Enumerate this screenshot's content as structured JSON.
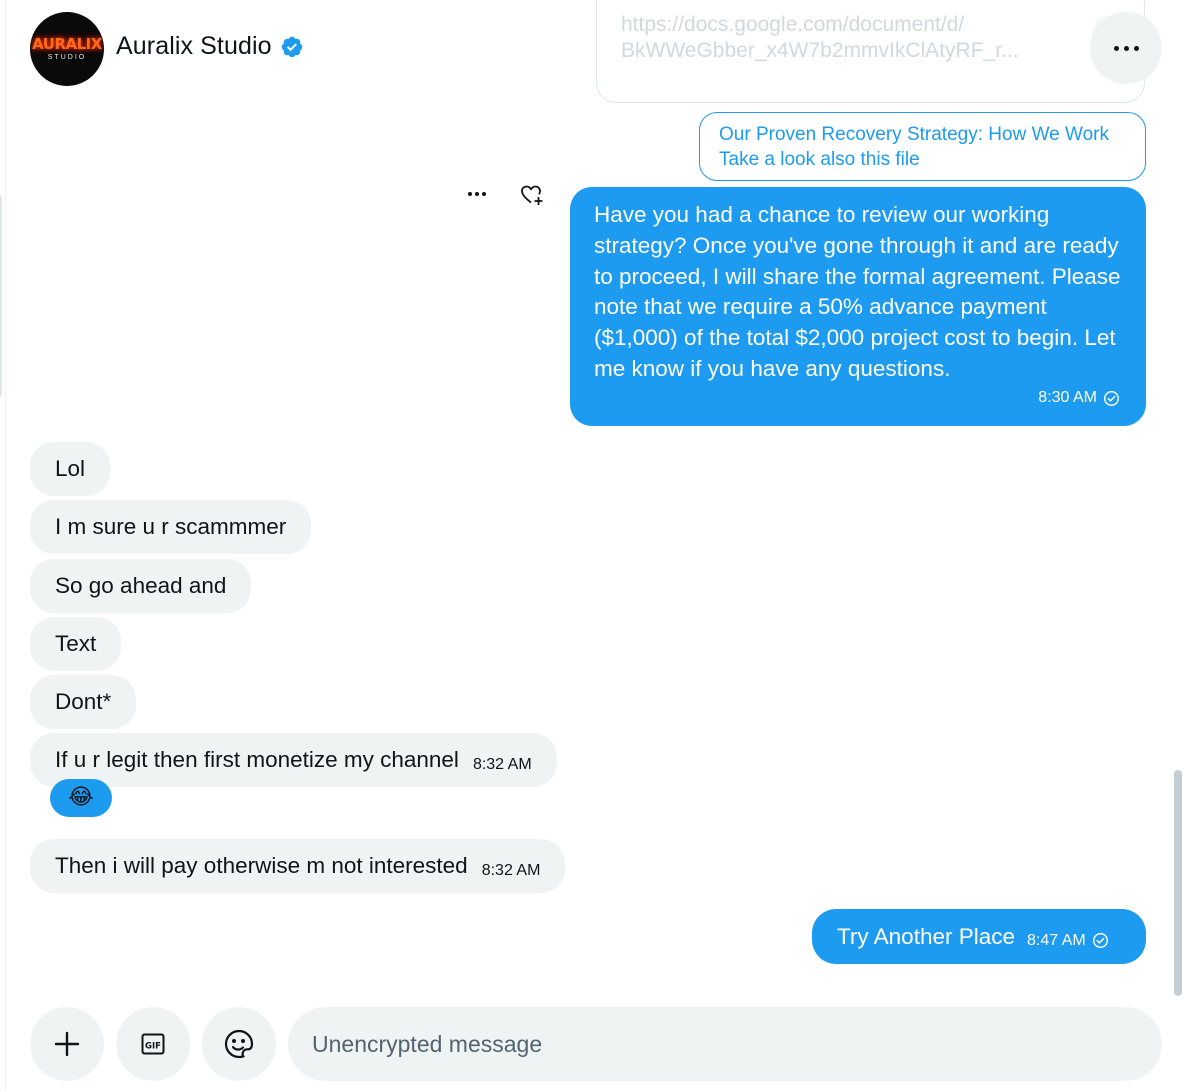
{
  "header": {
    "name": "Auralix Studio",
    "avatar_logo": "AURALIX",
    "avatar_sub": "STUDIO",
    "verified_icon": "verified-badge-icon",
    "more_icon": "more-horizontal-icon"
  },
  "link_preview": {
    "url_line1": "https://docs.google.com/document/d/",
    "url_line2": "BkWWeGbber_x4W7b2mmvIkClAtyRF_r..."
  },
  "outline_message": {
    "line1": "Our Proven Recovery Strategy: How We Work",
    "line2": "Take a look also this file"
  },
  "sent_message": {
    "text": "Have you had a chance to review our working strategy? Once you've gone through it and are ready to proceed, I will share the formal agreement. Please note that we require a 50% advance payment ($1,000) of the total $2,000 project cost to begin. Let me know if you have any questions.",
    "time": "8:30 AM",
    "status_icon": "sent-check-icon"
  },
  "received_messages": [
    {
      "text": "Lol",
      "time": ""
    },
    {
      "text": "I m sure u r scammmer",
      "time": ""
    },
    {
      "text": "So go ahead and",
      "time": ""
    },
    {
      "text": "Text",
      "time": ""
    },
    {
      "text": "Dont*",
      "time": ""
    },
    {
      "text": "If u r legit then first monetize my channel",
      "time": "8:32 AM",
      "reaction": "😂"
    },
    {
      "text": "Then i will pay otherwise m not interested",
      "time": "8:32 AM"
    }
  ],
  "last_sent": {
    "text": "Try Another Place",
    "time": "8:47 AM"
  },
  "composer": {
    "placeholder": "Unencrypted message",
    "add_icon": "plus-icon",
    "gif_label": "GIF",
    "emoji_icon": "emoji-icon"
  },
  "colors": {
    "accent": "#1d9bf0",
    "bubble_received": "#eff3f4",
    "text": "#0f1419",
    "muted": "#536471"
  }
}
